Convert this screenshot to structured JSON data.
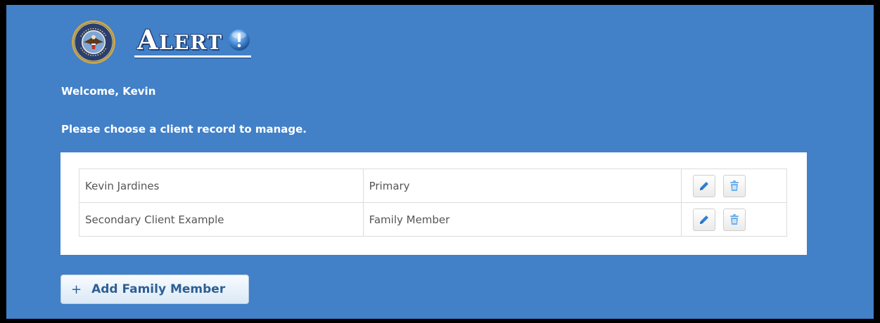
{
  "header": {
    "brand_text": "Alert",
    "seal_alt": "department-seal"
  },
  "greeting": "Welcome, Kevin",
  "prompt": "Please choose a client record to manage.",
  "clients": [
    {
      "name": "Kevin Jardines",
      "type": "Primary",
      "edit_icon": "pencil-icon",
      "delete_icon": "trash-icon"
    },
    {
      "name": "Secondary Client Example",
      "type": "Family Member",
      "edit_icon": "pencil-icon",
      "delete_icon": "trash-icon"
    }
  ],
  "add_button": {
    "icon": "+",
    "label": "Add Family Member"
  },
  "colors": {
    "background": "#4280c8",
    "accent_icon": "#2f7fd1",
    "button_text": "#2d5f94"
  }
}
